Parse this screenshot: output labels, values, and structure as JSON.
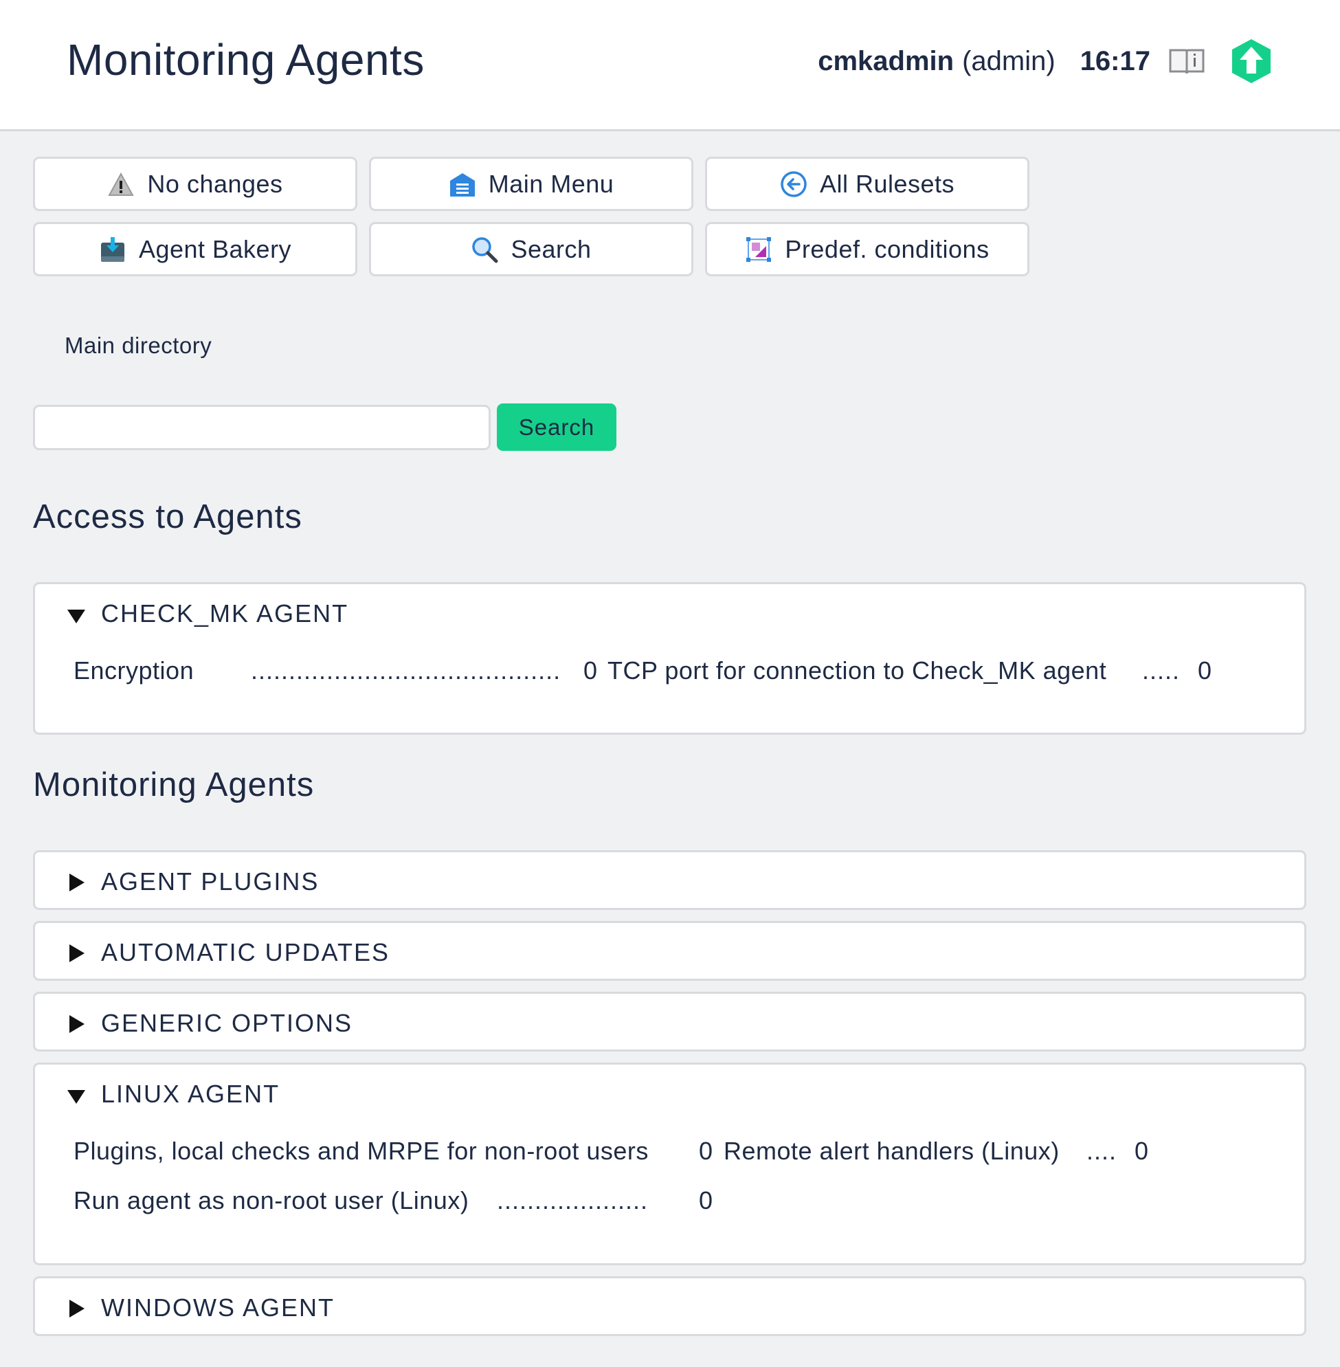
{
  "header": {
    "title": "Monitoring Agents",
    "user": "cmkadmin",
    "role": "(admin)",
    "time": "16:17"
  },
  "toolbar": {
    "buttons": [
      {
        "label": "No changes",
        "icon": "warning-icon"
      },
      {
        "label": "Main Menu",
        "icon": "home-icon"
      },
      {
        "label": "All Rulesets",
        "icon": "back-arrow-icon"
      },
      {
        "label": "Agent Bakery",
        "icon": "agent-bakery-icon"
      },
      {
        "label": "Search",
        "icon": "search-icon"
      },
      {
        "label": "Predef. conditions",
        "icon": "predefined-conditions-icon"
      }
    ]
  },
  "breadcrumb": {
    "label": "Main directory"
  },
  "search": {
    "value": "",
    "placeholder": "",
    "button_label": "Search"
  },
  "sections": [
    {
      "title": "Access to Agents",
      "groups": [
        {
          "title": "CHECK_MK AGENT",
          "expanded": true,
          "rules": [
            {
              "name": "Encryption",
              "count": "0"
            },
            {
              "name": "TCP port for connection to Check_MK agent",
              "count": "0"
            }
          ]
        }
      ]
    },
    {
      "title": "Monitoring Agents",
      "groups": [
        {
          "title": "AGENT PLUGINS",
          "expanded": false
        },
        {
          "title": "AUTOMATIC UPDATES",
          "expanded": false
        },
        {
          "title": "GENERIC OPTIONS",
          "expanded": false
        },
        {
          "title": "LINUX AGENT",
          "expanded": true,
          "rules": [
            {
              "name": "Plugins, local checks and MRPE for non-root users",
              "count": "0"
            },
            {
              "name": "Remote alert handlers (Linux)",
              "count": "0"
            },
            {
              "name": "Run agent as non-root user (Linux)",
              "count": "0"
            }
          ]
        },
        {
          "title": "WINDOWS AGENT",
          "expanded": false
        }
      ]
    }
  ],
  "colors": {
    "accent_green": "#15d08a",
    "background": "#f0f1f3",
    "text": "#1e2a44"
  }
}
